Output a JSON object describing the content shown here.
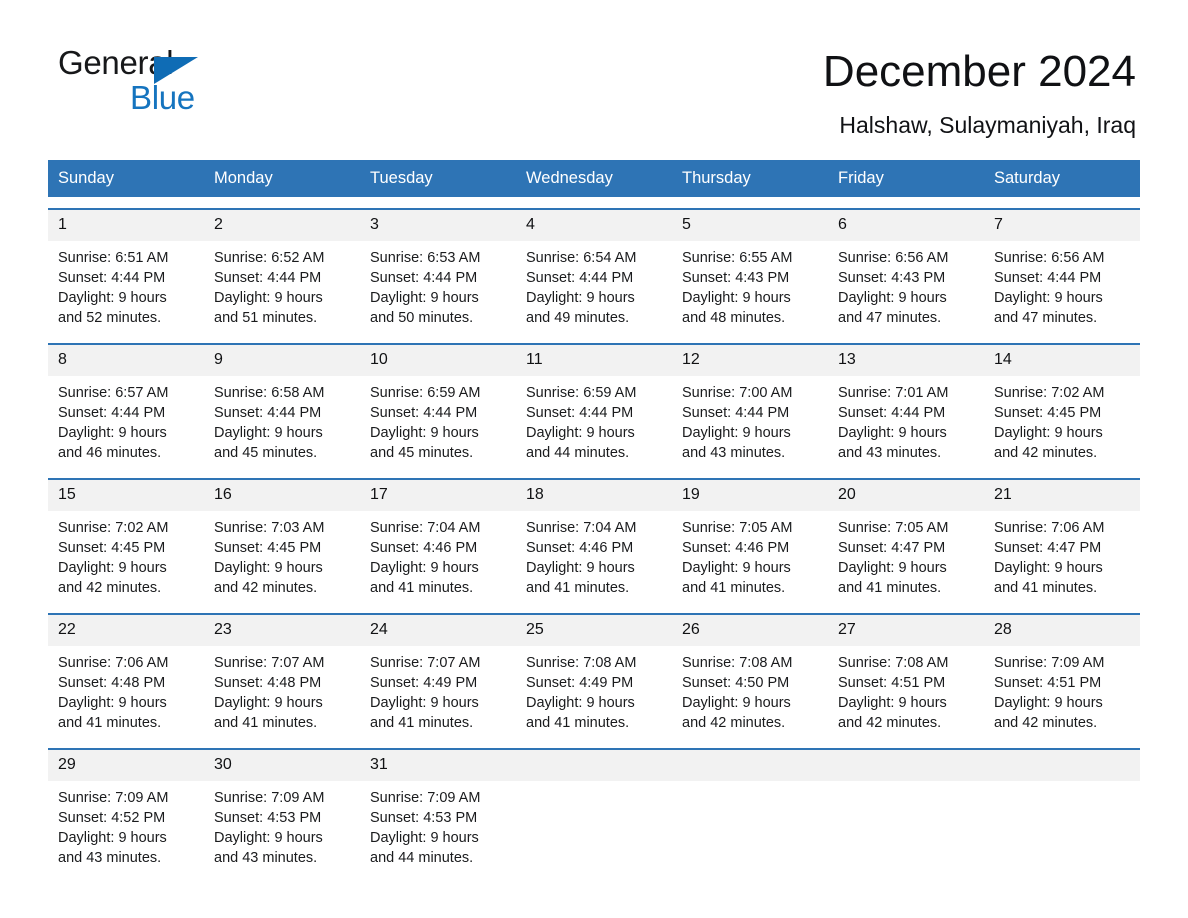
{
  "logo": {
    "word_one": "General",
    "word_two": "Blue",
    "triangle_color": "#0f6cb5",
    "blue_text_color": "#1574bf"
  },
  "header": {
    "title": "December 2024",
    "location": "Halshaw, Sulaymaniyah, Iraq"
  },
  "theme": {
    "header_blue": "#2e74b5",
    "daynum_band": "#f2f2f2",
    "text": "#111214"
  },
  "calendar": {
    "weekdays": [
      "Sunday",
      "Monday",
      "Tuesday",
      "Wednesday",
      "Thursday",
      "Friday",
      "Saturday"
    ],
    "weeks": [
      [
        {
          "day": "1",
          "sunrise": "Sunrise: 6:51 AM",
          "sunset": "Sunset: 4:44 PM",
          "daylight_line1": "Daylight: 9 hours",
          "daylight_line2": "and 52 minutes."
        },
        {
          "day": "2",
          "sunrise": "Sunrise: 6:52 AM",
          "sunset": "Sunset: 4:44 PM",
          "daylight_line1": "Daylight: 9 hours",
          "daylight_line2": "and 51 minutes."
        },
        {
          "day": "3",
          "sunrise": "Sunrise: 6:53 AM",
          "sunset": "Sunset: 4:44 PM",
          "daylight_line1": "Daylight: 9 hours",
          "daylight_line2": "and 50 minutes."
        },
        {
          "day": "4",
          "sunrise": "Sunrise: 6:54 AM",
          "sunset": "Sunset: 4:44 PM",
          "daylight_line1": "Daylight: 9 hours",
          "daylight_line2": "and 49 minutes."
        },
        {
          "day": "5",
          "sunrise": "Sunrise: 6:55 AM",
          "sunset": "Sunset: 4:43 PM",
          "daylight_line1": "Daylight: 9 hours",
          "daylight_line2": "and 48 minutes."
        },
        {
          "day": "6",
          "sunrise": "Sunrise: 6:56 AM",
          "sunset": "Sunset: 4:43 PM",
          "daylight_line1": "Daylight: 9 hours",
          "daylight_line2": "and 47 minutes."
        },
        {
          "day": "7",
          "sunrise": "Sunrise: 6:56 AM",
          "sunset": "Sunset: 4:44 PM",
          "daylight_line1": "Daylight: 9 hours",
          "daylight_line2": "and 47 minutes."
        }
      ],
      [
        {
          "day": "8",
          "sunrise": "Sunrise: 6:57 AM",
          "sunset": "Sunset: 4:44 PM",
          "daylight_line1": "Daylight: 9 hours",
          "daylight_line2": "and 46 minutes."
        },
        {
          "day": "9",
          "sunrise": "Sunrise: 6:58 AM",
          "sunset": "Sunset: 4:44 PM",
          "daylight_line1": "Daylight: 9 hours",
          "daylight_line2": "and 45 minutes."
        },
        {
          "day": "10",
          "sunrise": "Sunrise: 6:59 AM",
          "sunset": "Sunset: 4:44 PM",
          "daylight_line1": "Daylight: 9 hours",
          "daylight_line2": "and 45 minutes."
        },
        {
          "day": "11",
          "sunrise": "Sunrise: 6:59 AM",
          "sunset": "Sunset: 4:44 PM",
          "daylight_line1": "Daylight: 9 hours",
          "daylight_line2": "and 44 minutes."
        },
        {
          "day": "12",
          "sunrise": "Sunrise: 7:00 AM",
          "sunset": "Sunset: 4:44 PM",
          "daylight_line1": "Daylight: 9 hours",
          "daylight_line2": "and 43 minutes."
        },
        {
          "day": "13",
          "sunrise": "Sunrise: 7:01 AM",
          "sunset": "Sunset: 4:44 PM",
          "daylight_line1": "Daylight: 9 hours",
          "daylight_line2": "and 43 minutes."
        },
        {
          "day": "14",
          "sunrise": "Sunrise: 7:02 AM",
          "sunset": "Sunset: 4:45 PM",
          "daylight_line1": "Daylight: 9 hours",
          "daylight_line2": "and 42 minutes."
        }
      ],
      [
        {
          "day": "15",
          "sunrise": "Sunrise: 7:02 AM",
          "sunset": "Sunset: 4:45 PM",
          "daylight_line1": "Daylight: 9 hours",
          "daylight_line2": "and 42 minutes."
        },
        {
          "day": "16",
          "sunrise": "Sunrise: 7:03 AM",
          "sunset": "Sunset: 4:45 PM",
          "daylight_line1": "Daylight: 9 hours",
          "daylight_line2": "and 42 minutes."
        },
        {
          "day": "17",
          "sunrise": "Sunrise: 7:04 AM",
          "sunset": "Sunset: 4:46 PM",
          "daylight_line1": "Daylight: 9 hours",
          "daylight_line2": "and 41 minutes."
        },
        {
          "day": "18",
          "sunrise": "Sunrise: 7:04 AM",
          "sunset": "Sunset: 4:46 PM",
          "daylight_line1": "Daylight: 9 hours",
          "daylight_line2": "and 41 minutes."
        },
        {
          "day": "19",
          "sunrise": "Sunrise: 7:05 AM",
          "sunset": "Sunset: 4:46 PM",
          "daylight_line1": "Daylight: 9 hours",
          "daylight_line2": "and 41 minutes."
        },
        {
          "day": "20",
          "sunrise": "Sunrise: 7:05 AM",
          "sunset": "Sunset: 4:47 PM",
          "daylight_line1": "Daylight: 9 hours",
          "daylight_line2": "and 41 minutes."
        },
        {
          "day": "21",
          "sunrise": "Sunrise: 7:06 AM",
          "sunset": "Sunset: 4:47 PM",
          "daylight_line1": "Daylight: 9 hours",
          "daylight_line2": "and 41 minutes."
        }
      ],
      [
        {
          "day": "22",
          "sunrise": "Sunrise: 7:06 AM",
          "sunset": "Sunset: 4:48 PM",
          "daylight_line1": "Daylight: 9 hours",
          "daylight_line2": "and 41 minutes."
        },
        {
          "day": "23",
          "sunrise": "Sunrise: 7:07 AM",
          "sunset": "Sunset: 4:48 PM",
          "daylight_line1": "Daylight: 9 hours",
          "daylight_line2": "and 41 minutes."
        },
        {
          "day": "24",
          "sunrise": "Sunrise: 7:07 AM",
          "sunset": "Sunset: 4:49 PM",
          "daylight_line1": "Daylight: 9 hours",
          "daylight_line2": "and 41 minutes."
        },
        {
          "day": "25",
          "sunrise": "Sunrise: 7:08 AM",
          "sunset": "Sunset: 4:49 PM",
          "daylight_line1": "Daylight: 9 hours",
          "daylight_line2": "and 41 minutes."
        },
        {
          "day": "26",
          "sunrise": "Sunrise: 7:08 AM",
          "sunset": "Sunset: 4:50 PM",
          "daylight_line1": "Daylight: 9 hours",
          "daylight_line2": "and 42 minutes."
        },
        {
          "day": "27",
          "sunrise": "Sunrise: 7:08 AM",
          "sunset": "Sunset: 4:51 PM",
          "daylight_line1": "Daylight: 9 hours",
          "daylight_line2": "and 42 minutes."
        },
        {
          "day": "28",
          "sunrise": "Sunrise: 7:09 AM",
          "sunset": "Sunset: 4:51 PM",
          "daylight_line1": "Daylight: 9 hours",
          "daylight_line2": "and 42 minutes."
        }
      ],
      [
        {
          "day": "29",
          "sunrise": "Sunrise: 7:09 AM",
          "sunset": "Sunset: 4:52 PM",
          "daylight_line1": "Daylight: 9 hours",
          "daylight_line2": "and 43 minutes."
        },
        {
          "day": "30",
          "sunrise": "Sunrise: 7:09 AM",
          "sunset": "Sunset: 4:53 PM",
          "daylight_line1": "Daylight: 9 hours",
          "daylight_line2": "and 43 minutes."
        },
        {
          "day": "31",
          "sunrise": "Sunrise: 7:09 AM",
          "sunset": "Sunset: 4:53 PM",
          "daylight_line1": "Daylight: 9 hours",
          "daylight_line2": "and 44 minutes."
        },
        {
          "day": "",
          "sunrise": "",
          "sunset": "",
          "daylight_line1": "",
          "daylight_line2": ""
        },
        {
          "day": "",
          "sunrise": "",
          "sunset": "",
          "daylight_line1": "",
          "daylight_line2": ""
        },
        {
          "day": "",
          "sunrise": "",
          "sunset": "",
          "daylight_line1": "",
          "daylight_line2": ""
        },
        {
          "day": "",
          "sunrise": "",
          "sunset": "",
          "daylight_line1": "",
          "daylight_line2": ""
        }
      ]
    ]
  }
}
